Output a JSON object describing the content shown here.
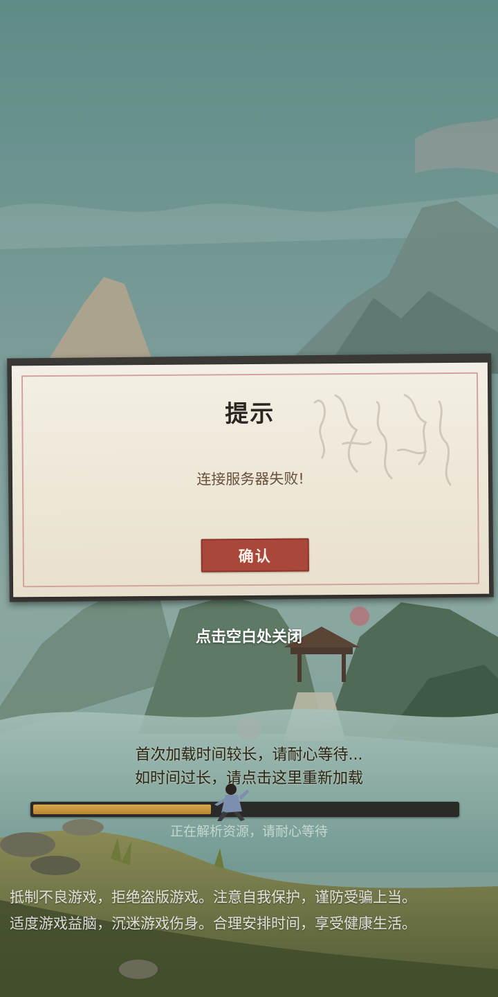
{
  "dialog": {
    "title": "提示",
    "message": "连接服务器失败!",
    "confirm_label": "确认"
  },
  "close_hint": "点击空白处关闭",
  "loading": {
    "line1": "首次加载时间较长，请耐心等待...",
    "line2": "如时间过长，请点击这里重新加载",
    "status": "正在解析资源，请耐心等待",
    "progress": 0.42
  },
  "notice": {
    "line1": "抵制不良游戏，拒绝盗版游戏。注意自我保护，谨防受骗上当。",
    "line2": "适度游戏益脑，沉迷游戏伤身。合理安排时间，享受健康生活。"
  },
  "colors": {
    "sky": "#6f948f",
    "dialog_paper": "#efe9dc",
    "dialog_border": "#d3a2a0",
    "confirm_button": "#a8473a",
    "progress_fill": "#c99a42",
    "progress_track": "#2a2b28"
  }
}
